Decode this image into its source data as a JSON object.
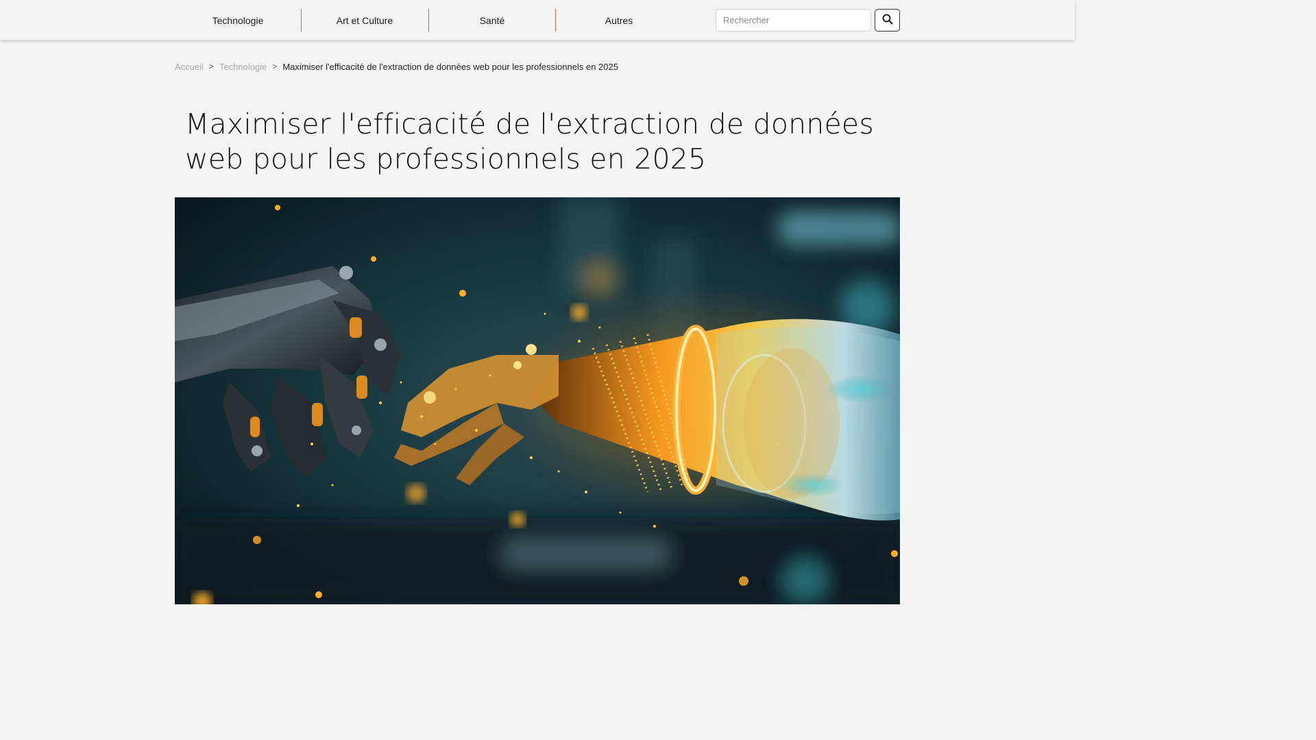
{
  "nav": {
    "items": [
      {
        "label": "Technologie"
      },
      {
        "label": "Art et Culture"
      },
      {
        "label": "Santé"
      },
      {
        "label": "Autres"
      }
    ],
    "search": {
      "placeholder": "Rechercher",
      "icon": "search-icon"
    },
    "separator_color": "#e0623a"
  },
  "breadcrumb": {
    "home": "Accueil",
    "category": "Technologie",
    "current": "Maximiser l'efficacité de l'extraction de données web pour les professionnels en 2025",
    "separator": ">"
  },
  "article": {
    "title": "Maximiser l'efficacité de l'extraction de données web pour les professionnels en 2025"
  },
  "hero": {
    "alt": "robot-hands-glowing-image"
  }
}
